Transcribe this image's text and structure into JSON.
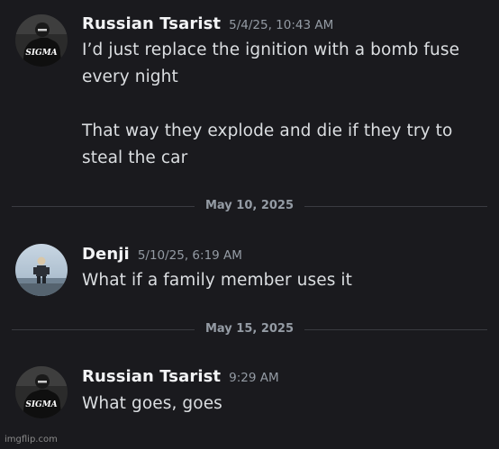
{
  "messages": [
    {
      "author": "Russian Tsarist",
      "timestamp": "5/4/25, 10:43 AM",
      "avatar_icon": "sigma-avatar",
      "lines": [
        "I’d just replace the ignition with a bomb fuse",
        "every night",
        "",
        "That way they explode and die if they try to",
        "steal the car"
      ]
    },
    {
      "author": "Denji",
      "timestamp": "5/10/25, 6:19 AM",
      "avatar_icon": "denji-avatar",
      "lines": [
        "What if a family member uses it"
      ]
    },
    {
      "author": "Russian Tsarist",
      "timestamp": "9:29 AM",
      "avatar_icon": "sigma-avatar",
      "lines": [
        "What goes, goes"
      ]
    }
  ],
  "dividers": [
    "May 10, 2025",
    "May 15, 2025"
  ],
  "watermark": "imgflip.com",
  "colors": {
    "background": "#1a1a1e",
    "author": "#f2f3f5",
    "message_text": "#dbdee1",
    "muted": "#949ba4",
    "divider_line": "#3a3b41"
  }
}
